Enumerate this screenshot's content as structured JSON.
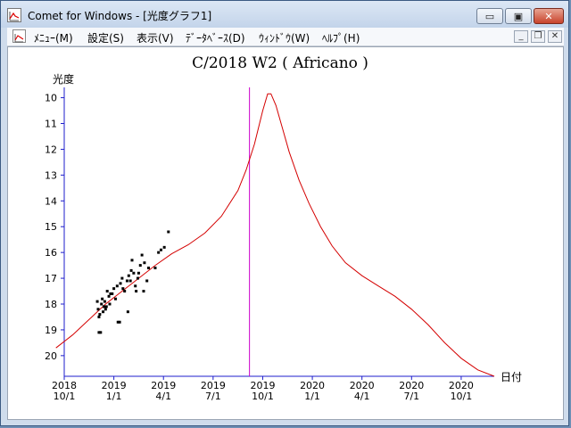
{
  "window": {
    "title": "Comet for Windows - [光度グラフ1]",
    "minimize_glyph": "▭",
    "maximize_glyph": "▣",
    "close_glyph": "✕"
  },
  "menubar": {
    "items": [
      "ﾒﾆｭｰ(M)",
      "設定(S)",
      "表示(V)",
      "ﾃﾞｰﾀﾍﾞｰｽ(D)",
      "ｳｨﾝﾄﾞｳ(W)",
      "ﾍﾙﾌﾟ(H)"
    ],
    "mdi_minimize_glyph": "_",
    "mdi_restore_glyph": "❐",
    "mdi_close_glyph": "✕"
  },
  "icons": {
    "app": "comet-app-icon",
    "doc": "comet-doc-icon"
  },
  "chart_data": {
    "type": "scatter",
    "title": "C/2018 W2 ( Africano )",
    "ylabel": "光度",
    "xlabel": "日付",
    "x_unit": "month index (0 = 2018-10-01)",
    "xlim": [
      0,
      26
    ],
    "ylim": [
      20.8,
      9.6
    ],
    "y_inverted": true,
    "y_ticks": [
      10,
      11,
      12,
      13,
      14,
      15,
      16,
      17,
      18,
      19,
      20
    ],
    "x_ticks": [
      {
        "x": 0,
        "year": "2018",
        "date": "10/1"
      },
      {
        "x": 3,
        "year": "2019",
        "date": "1/1"
      },
      {
        "x": 6,
        "year": "2019",
        "date": "4/1"
      },
      {
        "x": 9,
        "year": "2019",
        "date": "7/1"
      },
      {
        "x": 12,
        "year": "2019",
        "date": "10/1"
      },
      {
        "x": 15,
        "year": "2020",
        "date": "1/1"
      },
      {
        "x": 18,
        "year": "2020",
        "date": "4/1"
      },
      {
        "x": 21,
        "year": "2020",
        "date": "7/1"
      },
      {
        "x": 24,
        "year": "2020",
        "date": "10/1"
      }
    ],
    "current_date_x": 11.2,
    "colors": {
      "axis": "#1d1dcc",
      "curve": "#d40000",
      "marker": "#cc00cc",
      "points": "#000000"
    },
    "series": [
      {
        "kind": "predicted-curve",
        "points": [
          [
            -0.5,
            19.7
          ],
          [
            0.5,
            19.2
          ],
          [
            1.5,
            18.6
          ],
          [
            2.5,
            18.0
          ],
          [
            3.5,
            17.5
          ],
          [
            4.5,
            17.0
          ],
          [
            5.5,
            16.5
          ],
          [
            6.5,
            16.05
          ],
          [
            7.5,
            15.7
          ],
          [
            8.5,
            15.25
          ],
          [
            9.5,
            14.6
          ],
          [
            10.5,
            13.6
          ],
          [
            11.0,
            12.8
          ],
          [
            11.5,
            11.8
          ],
          [
            12.0,
            10.5
          ],
          [
            12.3,
            9.85
          ],
          [
            12.5,
            9.85
          ],
          [
            12.8,
            10.3
          ],
          [
            13.2,
            11.2
          ],
          [
            13.6,
            12.1
          ],
          [
            14.2,
            13.2
          ],
          [
            14.8,
            14.1
          ],
          [
            15.5,
            15.0
          ],
          [
            16.2,
            15.75
          ],
          [
            17.0,
            16.4
          ],
          [
            18.0,
            16.9
          ],
          [
            19.0,
            17.3
          ],
          [
            20.0,
            17.7
          ],
          [
            21.0,
            18.2
          ],
          [
            22.0,
            18.8
          ],
          [
            23.0,
            19.5
          ],
          [
            24.0,
            20.1
          ],
          [
            25.0,
            20.55
          ],
          [
            26.0,
            20.8
          ]
        ]
      },
      {
        "kind": "observations",
        "points": [
          [
            2.0,
            17.9
          ],
          [
            2.05,
            18.2
          ],
          [
            2.1,
            18.5
          ],
          [
            2.1,
            19.1
          ],
          [
            2.15,
            18.4
          ],
          [
            2.2,
            19.1
          ],
          [
            2.25,
            18.0
          ],
          [
            2.3,
            17.8
          ],
          [
            2.35,
            18.3
          ],
          [
            2.4,
            18.1
          ],
          [
            2.45,
            17.9
          ],
          [
            2.5,
            18.2
          ],
          [
            2.55,
            18.1
          ],
          [
            2.6,
            17.5
          ],
          [
            2.7,
            17.7
          ],
          [
            2.75,
            18.0
          ],
          [
            2.8,
            17.6
          ],
          [
            2.9,
            17.6
          ],
          [
            3.0,
            17.4
          ],
          [
            3.1,
            17.8
          ],
          [
            3.2,
            17.3
          ],
          [
            3.25,
            18.7
          ],
          [
            3.35,
            18.7
          ],
          [
            3.4,
            17.2
          ],
          [
            3.5,
            17.0
          ],
          [
            3.55,
            17.4
          ],
          [
            3.65,
            17.5
          ],
          [
            3.8,
            17.1
          ],
          [
            3.85,
            18.3
          ],
          [
            3.9,
            16.9
          ],
          [
            4.0,
            17.1
          ],
          [
            4.05,
            16.7
          ],
          [
            4.1,
            16.3
          ],
          [
            4.2,
            16.8
          ],
          [
            4.3,
            17.3
          ],
          [
            4.35,
            17.5
          ],
          [
            4.45,
            17.0
          ],
          [
            4.5,
            16.8
          ],
          [
            4.6,
            16.5
          ],
          [
            4.7,
            16.1
          ],
          [
            4.8,
            17.5
          ],
          [
            4.85,
            16.4
          ],
          [
            5.0,
            17.1
          ],
          [
            5.1,
            16.6
          ],
          [
            5.5,
            16.6
          ],
          [
            5.7,
            16.0
          ],
          [
            5.85,
            15.9
          ],
          [
            6.05,
            15.8
          ],
          [
            6.3,
            15.2
          ]
        ]
      }
    ]
  }
}
